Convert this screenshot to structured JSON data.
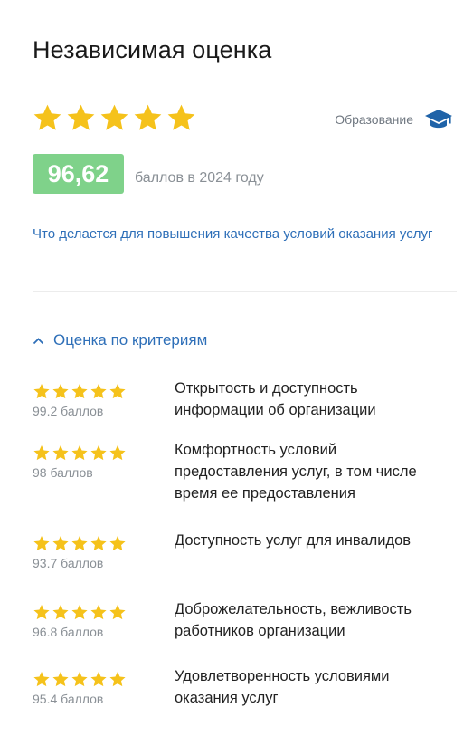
{
  "title": "Независимая оценка",
  "rating": {
    "stars": 5,
    "category_label": "Образование",
    "category_icon": "graduation-cap-icon",
    "score": "96,62",
    "score_caption": "баллов в 2024 году"
  },
  "improvement_link": "Что делается для повышения качества условий оказания услуг",
  "criteria_section": {
    "toggle_label": "Оценка по критериям",
    "toggle_icon": "chevron-up-icon",
    "items": [
      {
        "stars": 5,
        "score": "99.2 баллов",
        "label": "Открытость и доступность информации об организации"
      },
      {
        "stars": 5,
        "score": "98 баллов",
        "label": "Комфортность условий предоставления услуг, в том числе время ее предоставления"
      },
      {
        "stars": 5,
        "score": "93.7 баллов",
        "label": "Доступность услуг для инвалидов"
      },
      {
        "stars": 5,
        "score": "96.8 баллов",
        "label": "Доброжелательность, вежливость работников организации"
      },
      {
        "stars": 5,
        "score": "95.4 баллов",
        "label": "Удовлетворенность условиями оказания услуг"
      }
    ]
  },
  "colors": {
    "star": "#f5c21b",
    "badge_bg": "#7fd28a",
    "link": "#2e6fb8",
    "muted": "#8a9096",
    "cap_icon": "#1f63a8"
  }
}
